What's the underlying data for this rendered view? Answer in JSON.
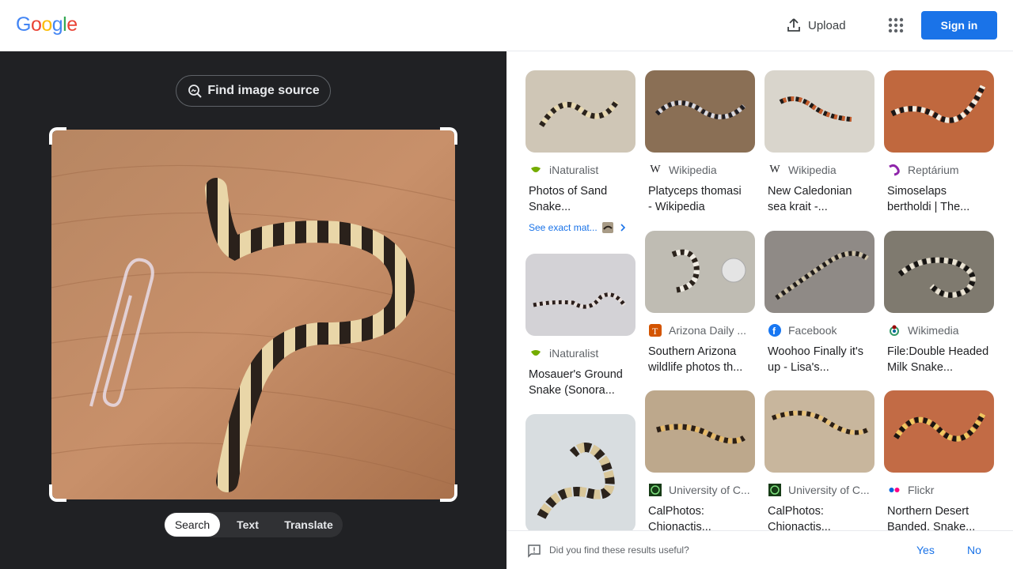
{
  "header": {
    "logo_letters": [
      "G",
      "o",
      "o",
      "g",
      "l",
      "e"
    ],
    "upload_label": "Upload",
    "signin_label": "Sign in"
  },
  "left": {
    "find_source_label": "Find image source",
    "modes": [
      "Search",
      "Text",
      "Translate"
    ],
    "active_mode": "Search"
  },
  "results": {
    "exact_matches_label": "See exact mat...",
    "cards": [
      {
        "source": "iNaturalist",
        "title_line1": "Photos of Sand",
        "title_line2": "Snake..."
      },
      {
        "source": "Wikipedia",
        "title_line1": "Platyceps thomasi",
        "title_line2": "- Wikipedia"
      },
      {
        "source": "Wikipedia",
        "title_line1": "New Caledonian",
        "title_line2": "sea krait -..."
      },
      {
        "source": "Reptárium",
        "title_line1": "Simoselaps",
        "title_line2": "bertholdi | The..."
      },
      {
        "source": "iNaturalist",
        "title_line1": "Mosauer's Ground",
        "title_line2": "Snake (Sonora..."
      },
      {
        "source": "Arizona Daily ...",
        "title_line1": "Southern Arizona",
        "title_line2": "wildlife photos th..."
      },
      {
        "source": "Facebook",
        "title_line1": "Woohoo Finally it's",
        "title_line2": "up - Lisa's..."
      },
      {
        "source": "Wikimedia",
        "title_line1": "File:Double Headed",
        "title_line2": "Milk Snake..."
      },
      {
        "source": "University of C...",
        "title_line1": "CalPhotos:",
        "title_line2": "Chionactis..."
      },
      {
        "source": "University of C...",
        "title_line1": "CalPhotos:",
        "title_line2": "Chionactis..."
      },
      {
        "source": "Flickr",
        "title_line1": "Northern Desert",
        "title_line2": "Banded, Snake..."
      }
    ]
  },
  "feedback": {
    "question": "Did you find these results useful?",
    "yes": "Yes",
    "no": "No"
  },
  "colors": {
    "accent": "#1a73e8",
    "dark_pane": "#202124"
  }
}
